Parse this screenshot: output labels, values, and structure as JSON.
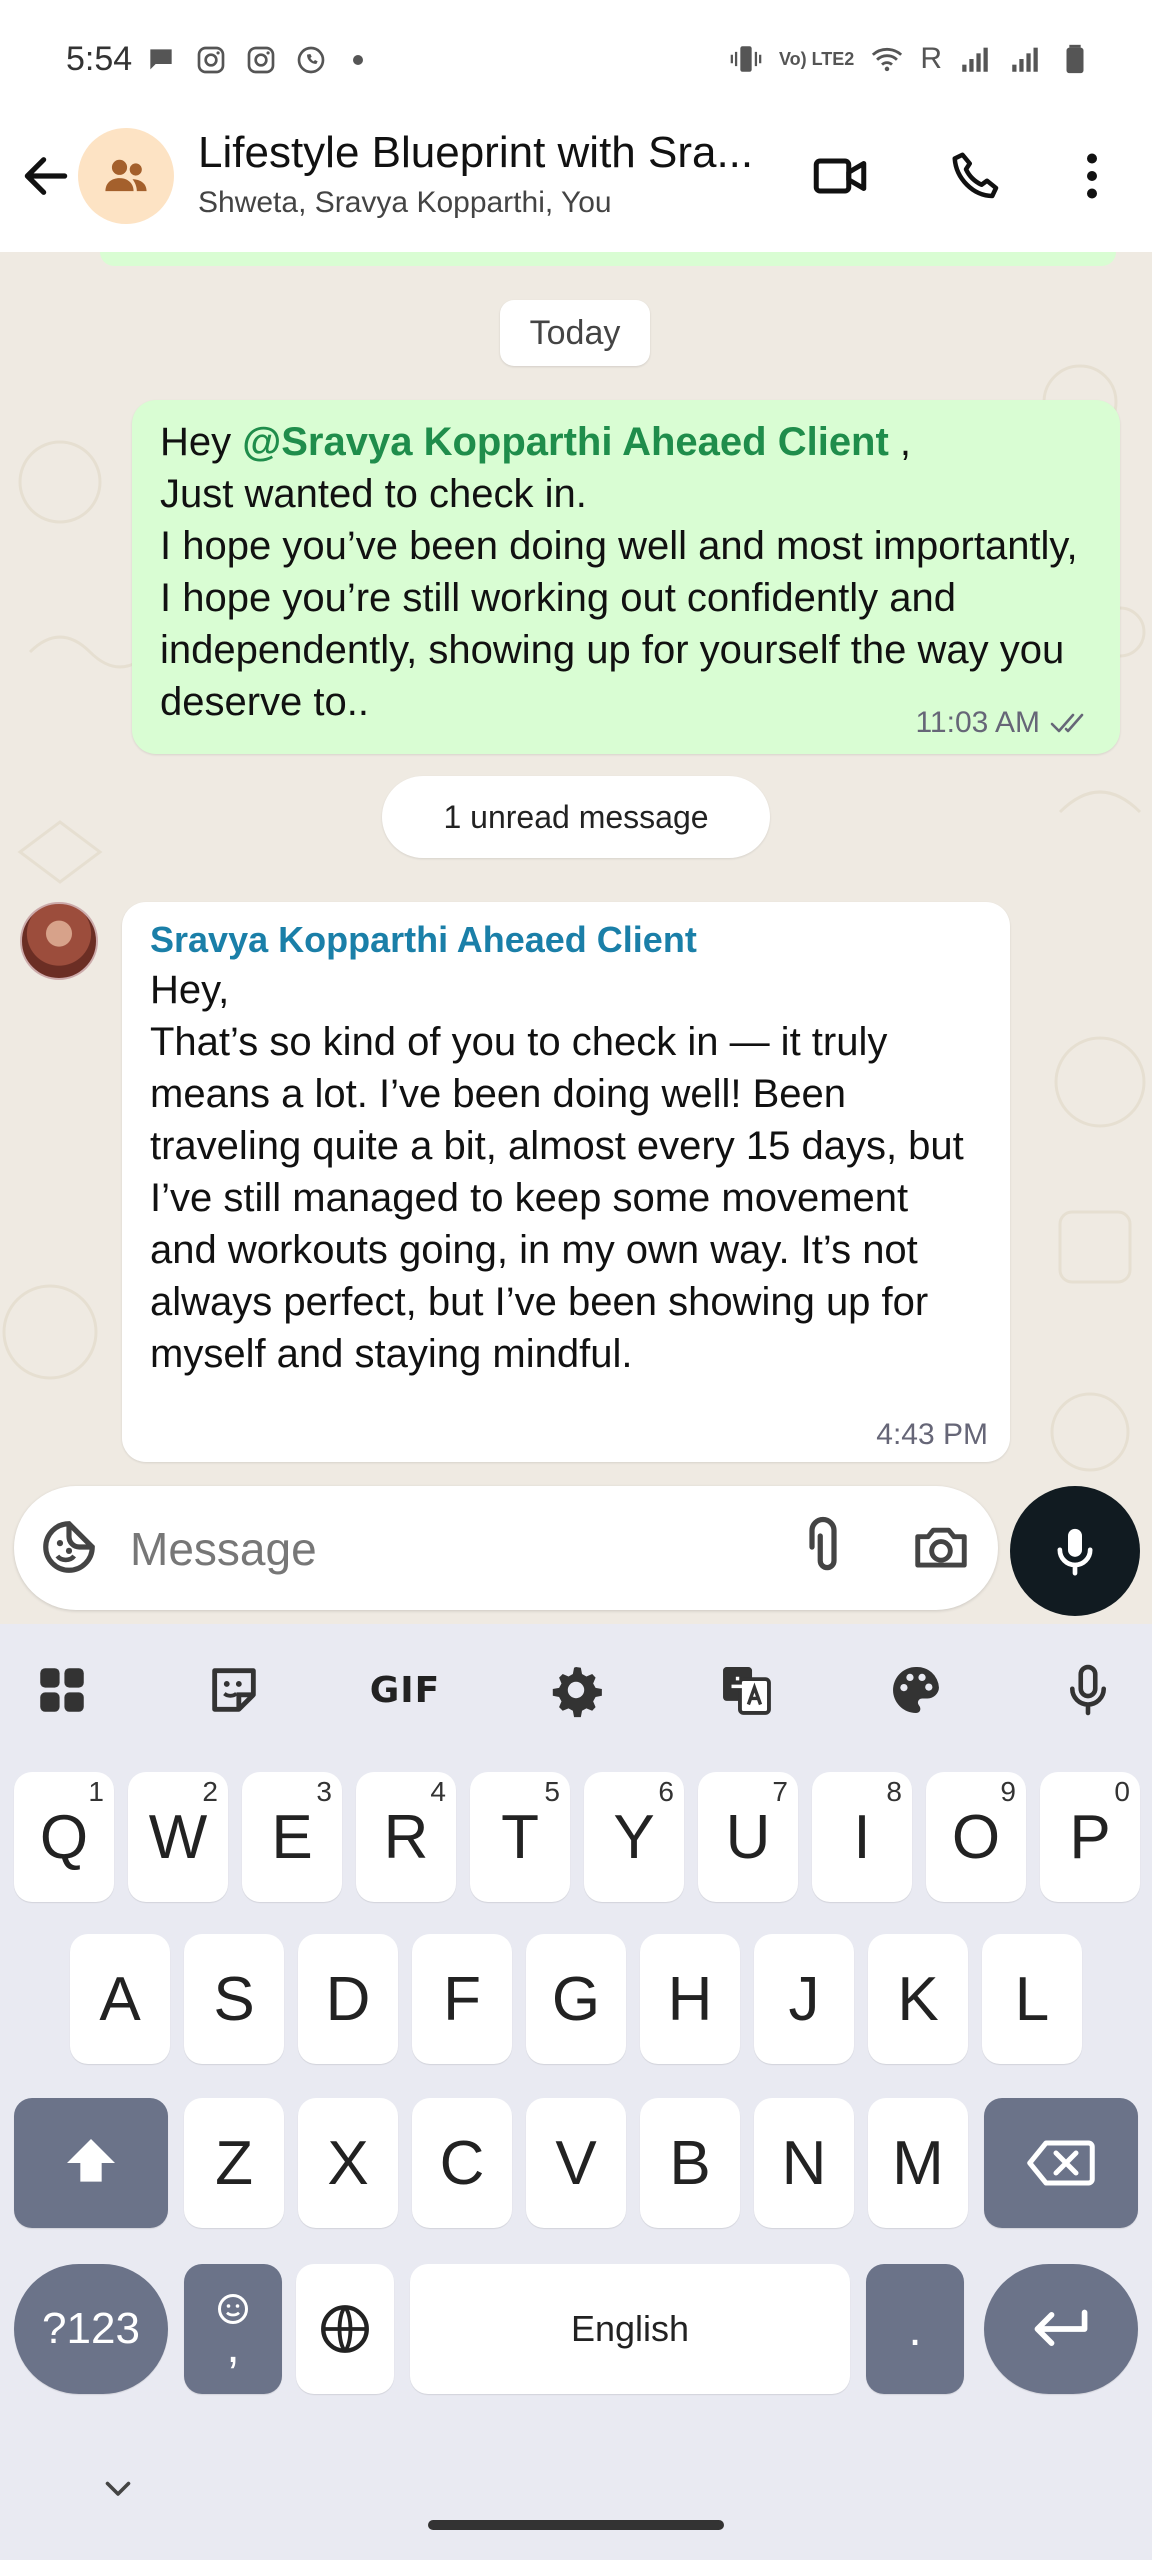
{
  "status_bar": {
    "time": "5:54",
    "lte_label": "Vo) LTE2",
    "roaming": "R"
  },
  "header": {
    "title": "Lifestyle Blueprint with Sra...",
    "participants": "Shweta, Sravya Kopparthi, You"
  },
  "chat": {
    "date_label": "Today",
    "outgoing": {
      "mention": "@Sravya Kopparthi Aheaed Client",
      "greeting": "Hey ",
      "after_mention": " ,",
      "body": "Just wanted to check in.\nI hope you’ve been doing well and most importantly, I hope you’re still working out confidently and independently, showing up for yourself the way you deserve to..",
      "time": "11:03 AM",
      "status": "read"
    },
    "unread_label": "1 unread message",
    "incoming": {
      "sender": "Sravya Kopparthi Aheaed Client",
      "body": "Hey,\nThat’s so kind of you to check in — it truly means a lot. I’ve been doing well! Been traveling quite a bit, almost every 15 days, but I’ve still managed to keep some movement and workouts going, in my own way. It’s not always perfect, but I’ve been showing up for myself and staying mindful.",
      "time": "4:43 PM"
    }
  },
  "composer": {
    "placeholder": "Message"
  },
  "keyboard": {
    "toolbar": {
      "gif_label": "GIF"
    },
    "row1": [
      {
        "key": "Q",
        "hint": "1"
      },
      {
        "key": "W",
        "hint": "2"
      },
      {
        "key": "E",
        "hint": "3"
      },
      {
        "key": "R",
        "hint": "4"
      },
      {
        "key": "T",
        "hint": "5"
      },
      {
        "key": "Y",
        "hint": "6"
      },
      {
        "key": "U",
        "hint": "7"
      },
      {
        "key": "I",
        "hint": "8"
      },
      {
        "key": "O",
        "hint": "9"
      },
      {
        "key": "P",
        "hint": "0"
      }
    ],
    "row2": [
      "A",
      "S",
      "D",
      "F",
      "G",
      "H",
      "J",
      "K",
      "L"
    ],
    "row3": [
      "Z",
      "X",
      "C",
      "V",
      "B",
      "N",
      "M"
    ],
    "symbols_label": "?123",
    "comma_label": ",",
    "space_label": "English",
    "period_label": "."
  },
  "colors": {
    "outgoing_bubble": "#d9fdd3",
    "incoming_bubble": "#ffffff",
    "mention": "#1f8d4b",
    "sender_name": "#1a7fa8",
    "chat_background": "#efeae2",
    "keyboard_background": "#e9eaf2",
    "dark_key": "#6b7389"
  },
  "icons": {
    "status_left": [
      "chat-bubble-icon",
      "instagram-icon",
      "instagram-icon",
      "whatsapp-icon"
    ],
    "status_right": [
      "vibrate-icon",
      "wifi-icon",
      "signal-icon",
      "signal-icon",
      "battery-icon"
    ],
    "header": [
      "back-arrow-icon",
      "group-icon",
      "video-call-icon",
      "voice-call-icon",
      "more-vert-icon"
    ],
    "composer": [
      "sticker-emoji-icon",
      "paperclip-icon",
      "camera-icon",
      "microphone-icon"
    ],
    "keyboard_toolbar": [
      "apps-grid-icon",
      "sticker-icon",
      "gif-icon",
      "settings-gear-icon",
      "translate-icon",
      "palette-icon",
      "voice-input-icon"
    ]
  }
}
